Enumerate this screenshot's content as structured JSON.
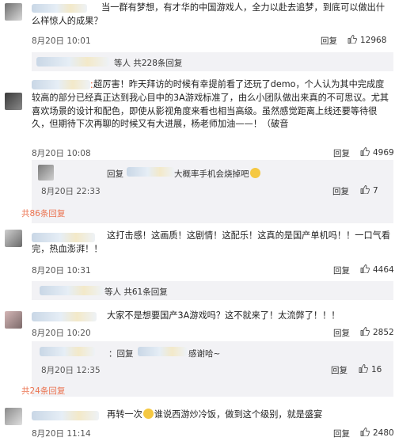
{
  "comments": [
    {
      "id": "c1",
      "text": "当一群有梦想，有才华的中国游戏人，全力以赴去追梦，到底可以做出什么样惊人的成果？",
      "time": "8月20日 10:01",
      "reply_label": "回复",
      "likes": "12968",
      "more": "等人 共228条回复"
    },
    {
      "id": "c2",
      "name_suffix": "：",
      "text": "超厉害！昨天拜访的时候有幸提前看了还玩了demo，个人认为其中完成度较高的部分已经真正达到我心目中的3A游戏标准了，由么小团队做出来真的不可思议。尤其喜欢场景的设计和配色，即使从影视角度来看也相当高级。虽然感觉距离上线还要等待很久，但期待下次再聊的时候又有大进展，杨老师加油——！（破音",
      "time": "8月20日 10:08",
      "reply_label": "回复",
      "likes": "4969",
      "sub_reply": {
        "prefix": "回复",
        "text": "大概率手机会烧掉吧",
        "time": "8月20日 22:33",
        "reply_label": "回复",
        "likes": "7"
      },
      "more": "共86条回复"
    },
    {
      "id": "c3",
      "text": "这打击感！这画质！这剧情！这配乐！这真的是国产单机吗！！一口气看完，热血澎湃！！",
      "time": "8月20日 10:31",
      "reply_label": "回复",
      "likes": "4464",
      "more": "等人 共61条回复"
    },
    {
      "id": "c4",
      "text": "大家不是想要国产3A游戏吗？这不就来了！太流弊了！！！",
      "time": "8月20日 10:20",
      "reply_label": "回复",
      "likes": "2852",
      "sub_reply": {
        "prefix": "：回复",
        "text": "感谢哈~",
        "time": "8月20日 12:35",
        "reply_label": "回复",
        "likes": "16"
      },
      "more": "共24条回复"
    },
    {
      "id": "c5",
      "text_a": "再转一次",
      "text_b": "谁说西游炒冷饭，做到这个级别，就是盛宴",
      "time": "8月20日 11:14",
      "reply_label": "回复",
      "likes": "2480"
    }
  ],
  "colors": {
    "link": "#eb7350",
    "reply_bg": "#f2f2f5"
  }
}
